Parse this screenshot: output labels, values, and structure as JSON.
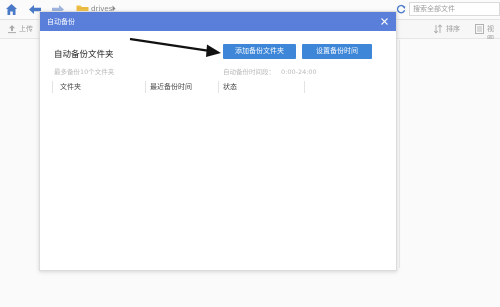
{
  "nav": {
    "path_folder": "drives",
    "search_placeholder": "搜索全部文件"
  },
  "toolbar": {
    "upload_label": "上传",
    "sort_label": "排序",
    "view_label": "视图"
  },
  "dialog": {
    "title": "自动备份",
    "section_title": "自动备份文件夹",
    "add_button": "添加备份文件夹",
    "time_button": "设置备份时间",
    "max_hint": "最多备份10个文件夹",
    "time_hint_label": "自动备份时间段：",
    "time_hint_value": "0:00-24:00",
    "columns": [
      "文件夹",
      "最近备份时间",
      "状态"
    ]
  },
  "colors": {
    "header": "#5a7fda",
    "button": "#3d86d8",
    "accent_icon": "#4a79c8"
  },
  "icons": {
    "home": "home-icon",
    "back": "back-arrow-icon",
    "forward": "forward-arrow-icon",
    "folder": "folder-icon",
    "refresh": "refresh-icon",
    "upload": "upload-icon",
    "sort": "sort-icon",
    "view": "view-icon",
    "close": "close-icon"
  }
}
